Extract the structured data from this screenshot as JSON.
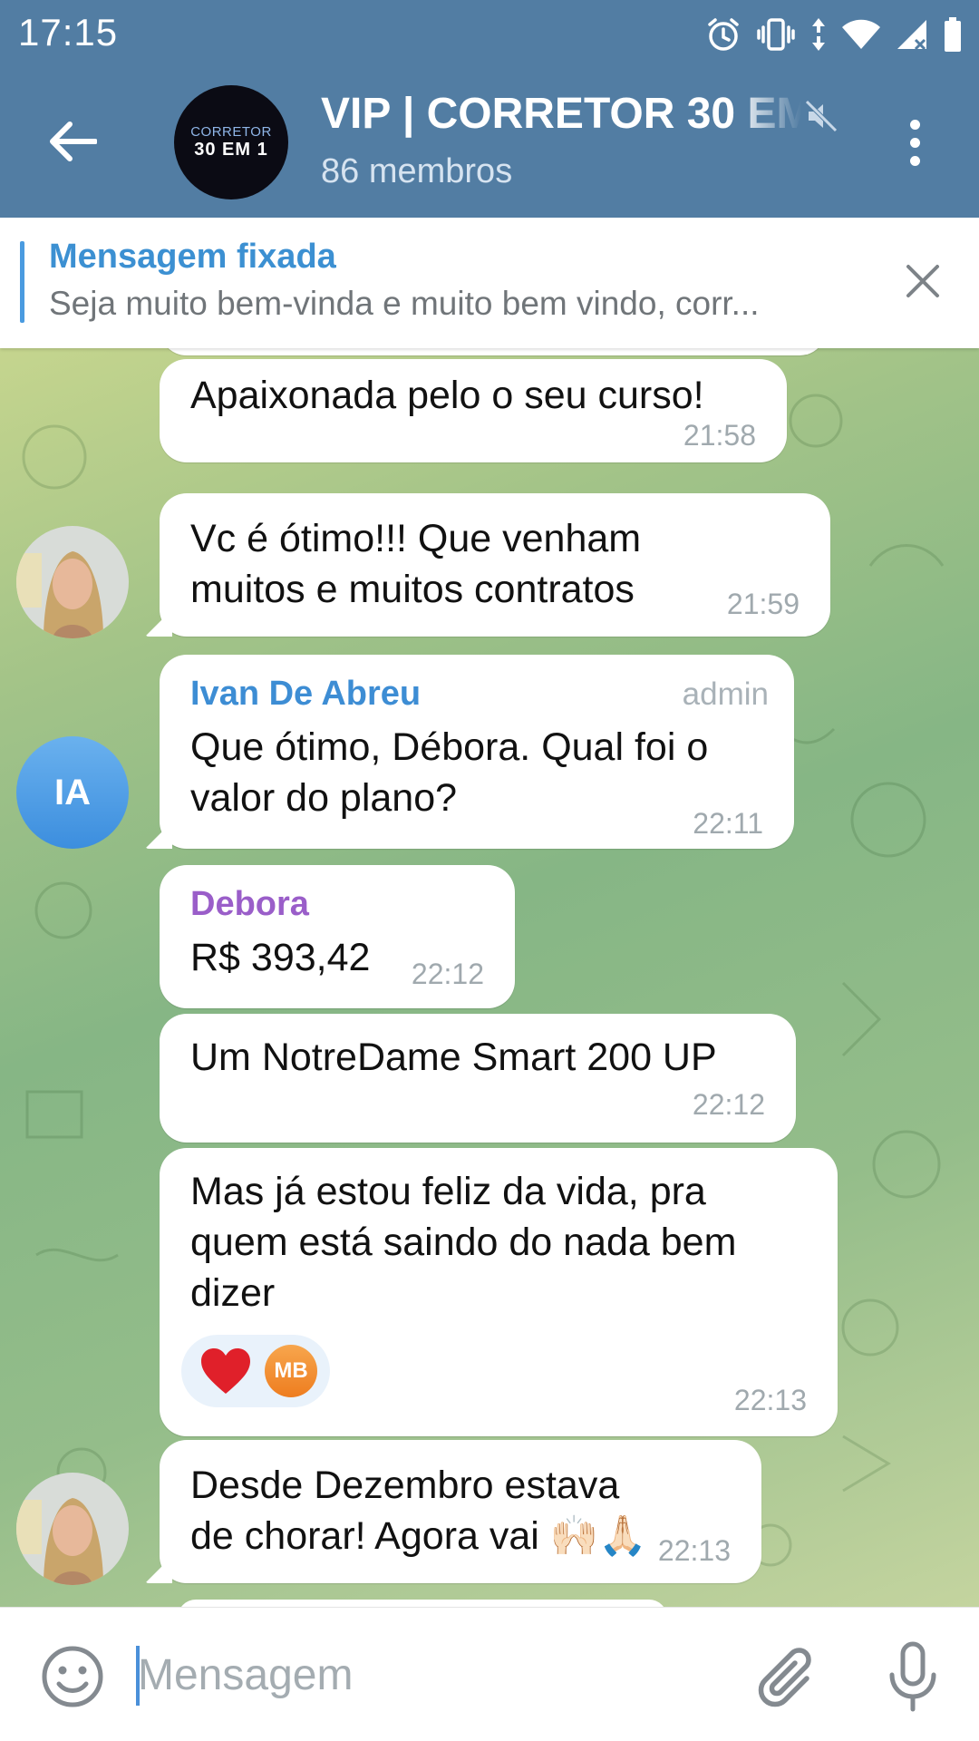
{
  "status_bar": {
    "time": "17:15"
  },
  "header": {
    "back_label": "Voltar",
    "avatar_logo_top": "CORRETOR",
    "avatar_logo_main": "30 EM 1",
    "title": "VIP | CORRETOR 30 EM 1",
    "subtitle": "86 membros"
  },
  "pinned": {
    "title": "Mensagem fixada",
    "text": "Seja muito bem-vinda e muito bem vindo, corr..."
  },
  "messages": [
    {
      "text": "Apaixonada pelo o seu curso!",
      "time": "21:58"
    },
    {
      "text": "Vc é ótimo!!! Que venham muitos e muitos contratos",
      "time": "21:59"
    },
    {
      "sender": "Ivan De Abreu",
      "badge": "admin",
      "avatar_initials": "IA",
      "text": "Que ótimo, Débora. Qual foi o valor do plano?",
      "time": "22:11"
    },
    {
      "sender": "Debora",
      "text": "R$ 393,42",
      "time": "22:12"
    },
    {
      "text": "Um NotreDame Smart 200 UP",
      "time": "22:12"
    },
    {
      "text": "Mas já estou feliz da vida, pra quem está saindo do nada bem dizer",
      "time": "22:13",
      "reaction_emoji": "❤️",
      "reaction_user": "MB"
    },
    {
      "text": "Desde Dezembro estava de chorar! Agora vai 🙌🏻🙏🏻",
      "time": "22:13"
    }
  ],
  "input": {
    "placeholder": "Mensagem"
  },
  "colors": {
    "header": "#527da3",
    "accent": "#3c90d2",
    "sender_ivan": "#3d8dd4",
    "sender_debora": "#9a5ec9"
  },
  "icons": [
    "back-arrow-icon",
    "mute-icon",
    "more-vertical-icon",
    "close-icon",
    "emoji-icon",
    "paperclip-icon",
    "microphone-icon"
  ]
}
